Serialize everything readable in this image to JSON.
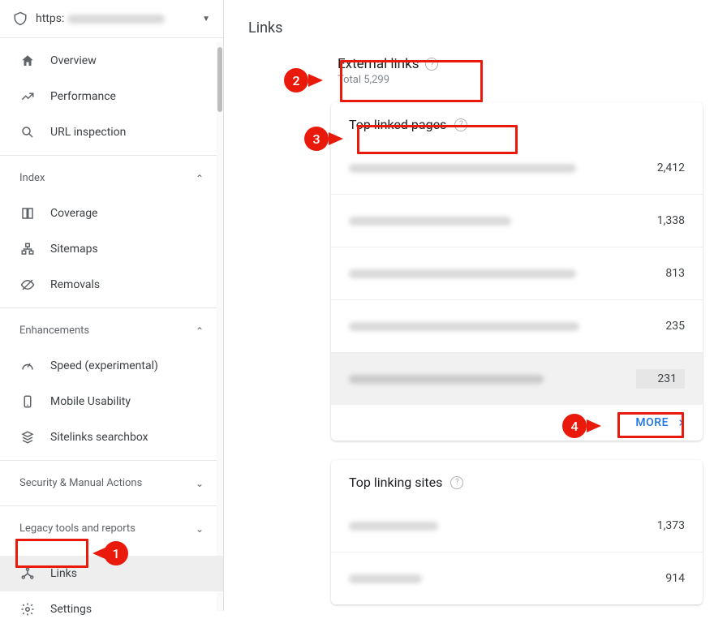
{
  "property": {
    "prefix": "https:"
  },
  "nav": {
    "overview": "Overview",
    "performance": "Performance",
    "url_inspection": "URL inspection",
    "section_index": "Index",
    "coverage": "Coverage",
    "sitemaps": "Sitemaps",
    "removals": "Removals",
    "section_enhancements": "Enhancements",
    "speed": "Speed (experimental)",
    "mobile_usability": "Mobile Usability",
    "sitelinks": "Sitelinks searchbox",
    "section_security": "Security & Manual Actions",
    "section_legacy": "Legacy tools and reports",
    "links": "Links",
    "settings": "Settings"
  },
  "page": {
    "title": "Links"
  },
  "external": {
    "title": "External links",
    "total_label": "Total 5,299"
  },
  "top_linked_pages": {
    "title": "Top linked pages",
    "rows": [
      {
        "value": "2,412"
      },
      {
        "value": "1,338"
      },
      {
        "value": "813"
      },
      {
        "value": "235"
      },
      {
        "value": "231"
      }
    ],
    "more": "MORE"
  },
  "top_linking_sites": {
    "title": "Top linking sites",
    "rows": [
      {
        "value": "1,373"
      },
      {
        "value": "914"
      }
    ]
  },
  "annotations": {
    "a1": "1",
    "a2": "2",
    "a3": "3",
    "a4": "4"
  }
}
